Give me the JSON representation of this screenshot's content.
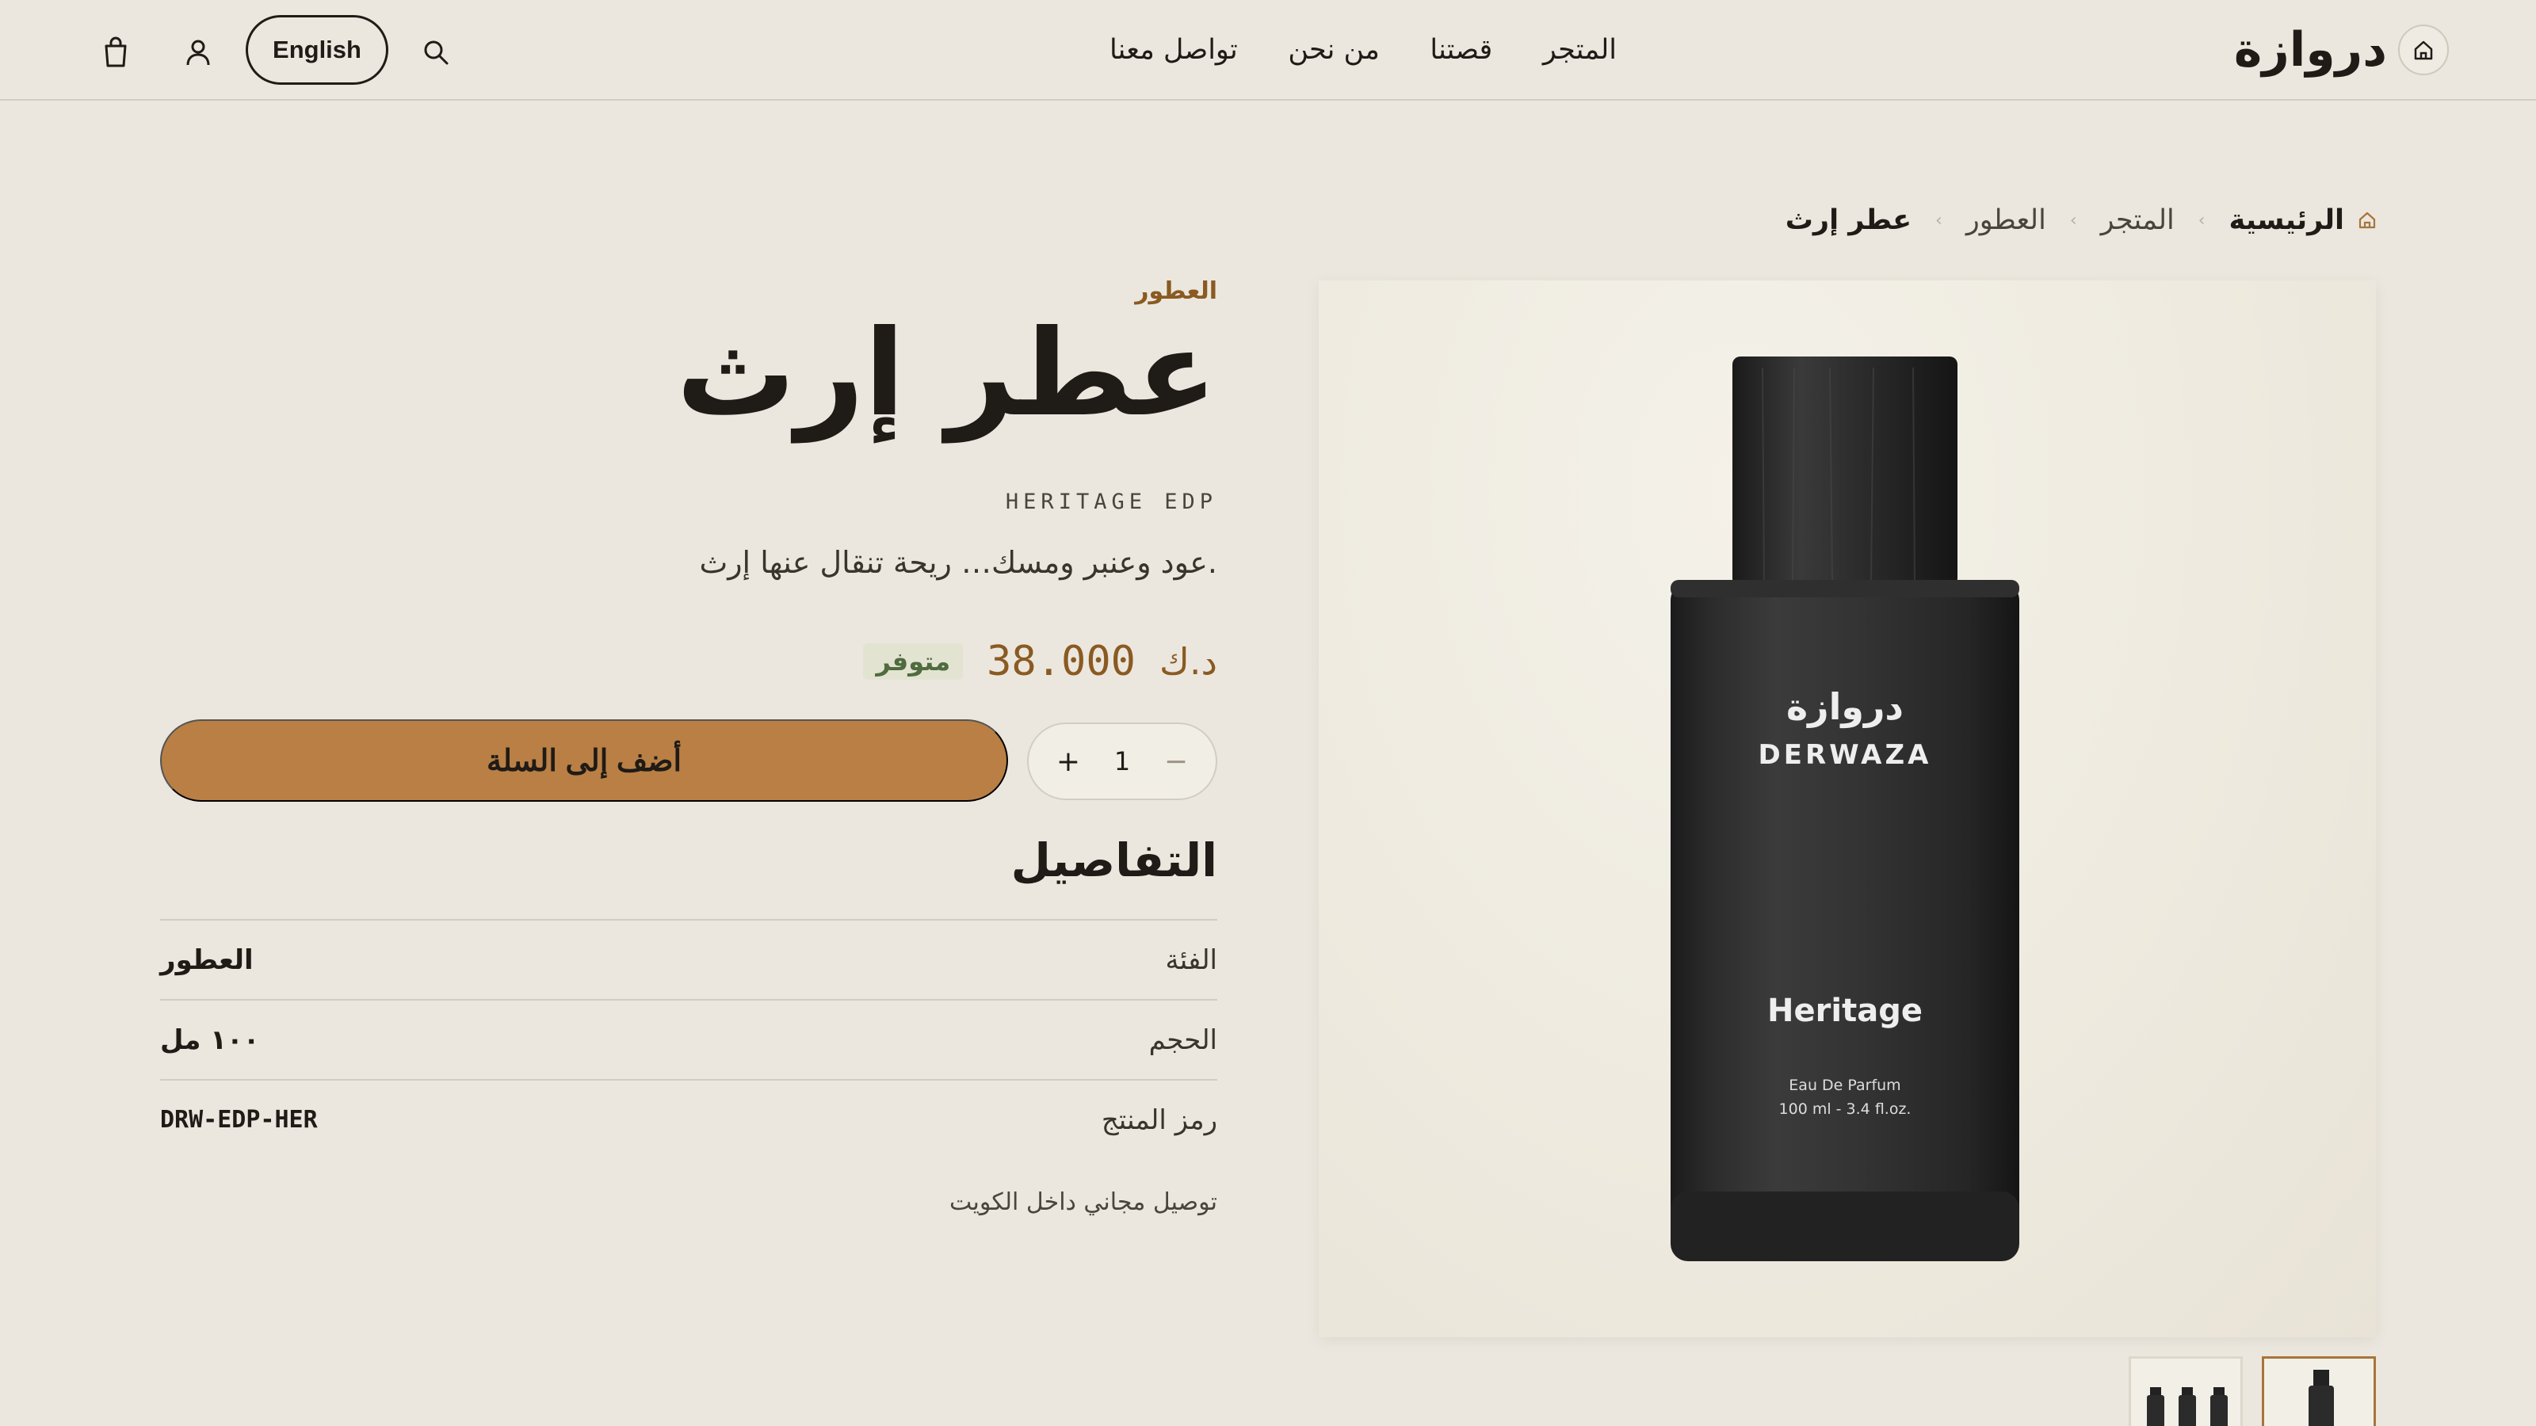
{
  "header": {
    "brand_name": "دروازة",
    "nav": [
      {
        "label": "المتجر"
      },
      {
        "label": "قصتنا"
      },
      {
        "label": "من نحن"
      },
      {
        "label": "تواصل معنا"
      }
    ],
    "language_button": "English",
    "icons": [
      "home-icon",
      "search-icon",
      "user-icon",
      "shopping-bag-icon"
    ]
  },
  "breadcrumb": {
    "home": "الرئيسية",
    "shop": "المتجر",
    "category": "العطور",
    "current": "عطر إرث"
  },
  "product": {
    "category": "العطور",
    "title": "عطر إرث",
    "subtitle": "HERITAGE EDP",
    "description": "عود وعنبر ومسك… ريحة تنقال عنها إرث.",
    "currency": "د.ك",
    "price": "38.000",
    "stock_status": "متوفر",
    "quantity": "1",
    "add_to_cart_label": "أضف إلى السلة",
    "bottle_label": {
      "brand_ar": "دروازة",
      "brand_en": "DERWAZA",
      "name": "Heritage",
      "type": "Eau De Parfum",
      "volume": "100 ml - 3.4 fl.oz."
    }
  },
  "details": {
    "heading": "التفاصيل",
    "rows": [
      {
        "label": "الفئة",
        "value": "العطور"
      },
      {
        "label": "الحجم",
        "value": "١٠٠ مل"
      },
      {
        "label": "رمز المنتج",
        "value": "DRW-EDP-HER"
      }
    ]
  },
  "shipping_note": "توصيل مجاني داخل الكويت",
  "colors": {
    "background": "#ebe7de",
    "accent": "#b97f44",
    "brown_text": "#8a5a22",
    "stock_green": "#4f6b3f",
    "dark": "#1f1b16"
  }
}
